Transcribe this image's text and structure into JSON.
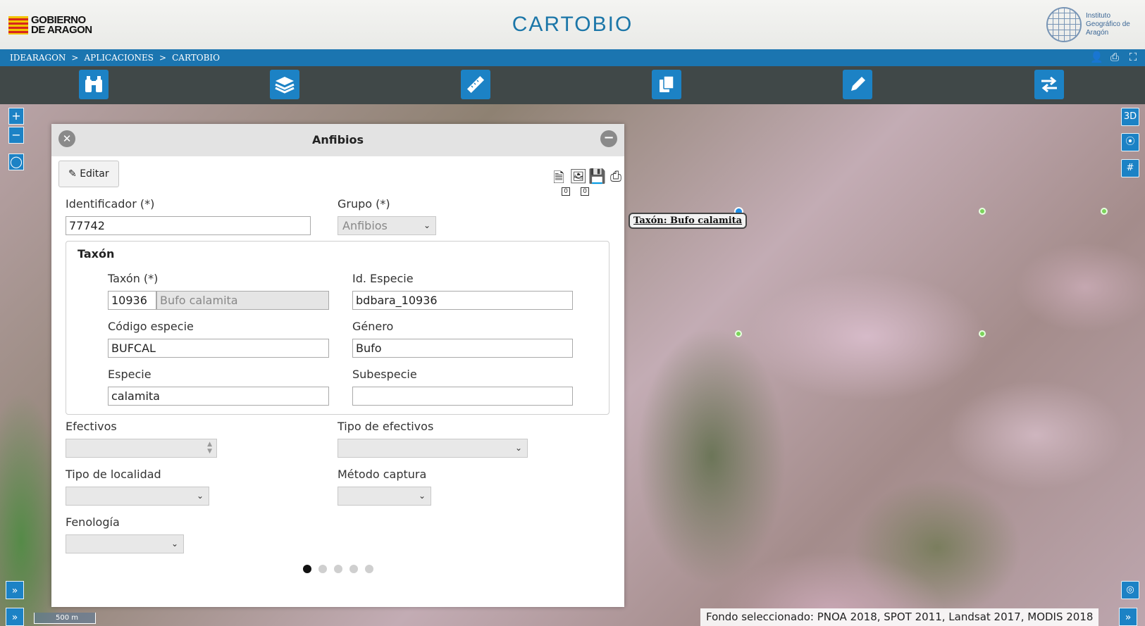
{
  "header": {
    "gobierno_line1": "GOBIERNO",
    "gobierno_line2": "DE ARAGON",
    "app_title": "CARTOBIO",
    "iga_line1": "Instituto",
    "iga_line2": "Geográfico de",
    "iga_line3": "Aragón"
  },
  "breadcrumb": {
    "items": [
      "IDEARAGON",
      "APLICACIONES",
      "CARTOBIO"
    ],
    "separator": ">"
  },
  "top_right_tools": [
    "user-icon",
    "print-icon",
    "fullscreen-icon"
  ],
  "toolbar": {
    "buttons": [
      "binoculars-icon",
      "layers-icon",
      "ruler-icon",
      "copy-icon",
      "pencil-icon",
      "swap-arrows-icon"
    ]
  },
  "map_controls": {
    "zoom_in": "+",
    "zoom_out": "−",
    "threed": "3D"
  },
  "map": {
    "tooltip": "Taxón: Bufo calamita",
    "scale": "500 m",
    "footer": "Fondo seleccionado: PNOA 2018, SPOT 2011, Landsat 2017, MODIS 2018",
    "expand": "»"
  },
  "panel": {
    "title": "Anfibios",
    "edit_label": "Editar",
    "doc_count_1": "0",
    "doc_count_2": "0",
    "fields": {
      "identificador_label": "Identificador (*)",
      "identificador_value": "77742",
      "grupo_label": "Grupo (*)",
      "grupo_value": "Anfibios",
      "taxon_legend": "Taxón",
      "taxon_label": "Taxón (*)",
      "taxon_id": "10936",
      "taxon_name": "Bufo calamita",
      "id_especie_label": "Id. Especie",
      "id_especie_value": "bdbara_10936",
      "codigo_label": "Código especie",
      "codigo_value": "BUFCAL",
      "genero_label": "Género",
      "genero_value": "Bufo",
      "especie_label": "Especie",
      "especie_value": "calamita",
      "subespecie_label": "Subespecie",
      "subespecie_value": "",
      "efectivos_label": "Efectivos",
      "tipo_efectivos_label": "Tipo de efectivos",
      "tipo_localidad_label": "Tipo de localidad",
      "metodo_label": "Método captura",
      "fenologia_label": "Fenología"
    },
    "pager": {
      "pages": 5,
      "current": 1
    }
  },
  "colors": {
    "accent_blue": "#1c82c5",
    "breadcrumb_bar": "#1b75b0",
    "title_blue": "#1b76a8",
    "marker_green": "#7bd35a",
    "marker_blue": "#1e8ee8"
  }
}
